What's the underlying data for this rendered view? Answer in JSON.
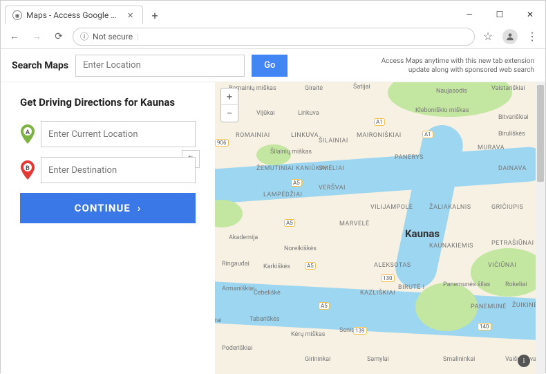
{
  "window": {
    "tab_title": "Maps - Access Google Maps Dri...",
    "minimize": "—",
    "maximize": "☐",
    "close": "✕",
    "plus": "+"
  },
  "addressbar": {
    "back": "←",
    "forward": "→",
    "reload": "⟳",
    "security_icon": "ⓘ",
    "security_text": "Not secure",
    "separator": "|",
    "star": "☆",
    "kebab": "⋮"
  },
  "search": {
    "title": "Search Maps",
    "placeholder": "Enter Location",
    "go_label": "Go",
    "promo_line1": "Access Maps anytime with this new tab extension",
    "promo_line2": "update along with sponsored web search"
  },
  "directions": {
    "heading": "Get Driving Directions for Kaunas",
    "origin_placeholder": "Enter Current Location",
    "dest_placeholder": "Enter Destination",
    "continue_label": "CONTINUE",
    "continue_arrow": "›",
    "pin_a_label": "A",
    "pin_b_label": "B",
    "swap": "⇅"
  },
  "map": {
    "zoom_in": "+",
    "zoom_out": "−",
    "city": "Kaunas",
    "info": "i",
    "districts": [
      "Ramainių miškas",
      "Giraitė",
      "Šatijai",
      "Naujasodis",
      "Vaistariškiai",
      "Vijūkai",
      "Linkuva",
      "Bitvariškiai",
      "Kleboniškio miškas",
      "Biruliškės",
      "ROMAINIAI",
      "LINKUVA",
      "ŠILAINIAI",
      "MAIRONIŠKIAI",
      "MURAVA",
      "Šilainių miškas",
      "ŽEMUTINIAI KANIŪKAI",
      "SMĖLIAI",
      "PANERYS",
      "DAINAVA",
      "LAMPĖDŽIAI",
      "VERŠVAI",
      "VILIJAMPOLĖ",
      "ŽALIAKALNIS",
      "GRIČIUPIS",
      "MARVELĖ",
      "Akademija",
      "Noreikiškės",
      "KAUNAKIEMIS",
      "PETRAŠIŪNAI",
      "Ringaudai",
      "Karkiškės",
      "ALEKSOTAS",
      "VIČIŪNAI",
      "Panemunės šilas",
      "Armaniškiai",
      "Čebeliškė",
      "KAZLIŠKIAI",
      "BIRUTĖ I",
      "Rokeliai",
      "PANEMUNĖ",
      "ŽUIKINĖ",
      "Pažėrai",
      "Tabariškės",
      "Kėrų miškas",
      "Poderiškiai",
      "Girininkai",
      "Samylai",
      "Smalininkai",
      "Vaišvydava",
      "Seniava"
    ],
    "road_labels": [
      "A1",
      "A1",
      "A5",
      "A5",
      "A5",
      "A5",
      "906",
      "130",
      "139",
      "140"
    ]
  }
}
